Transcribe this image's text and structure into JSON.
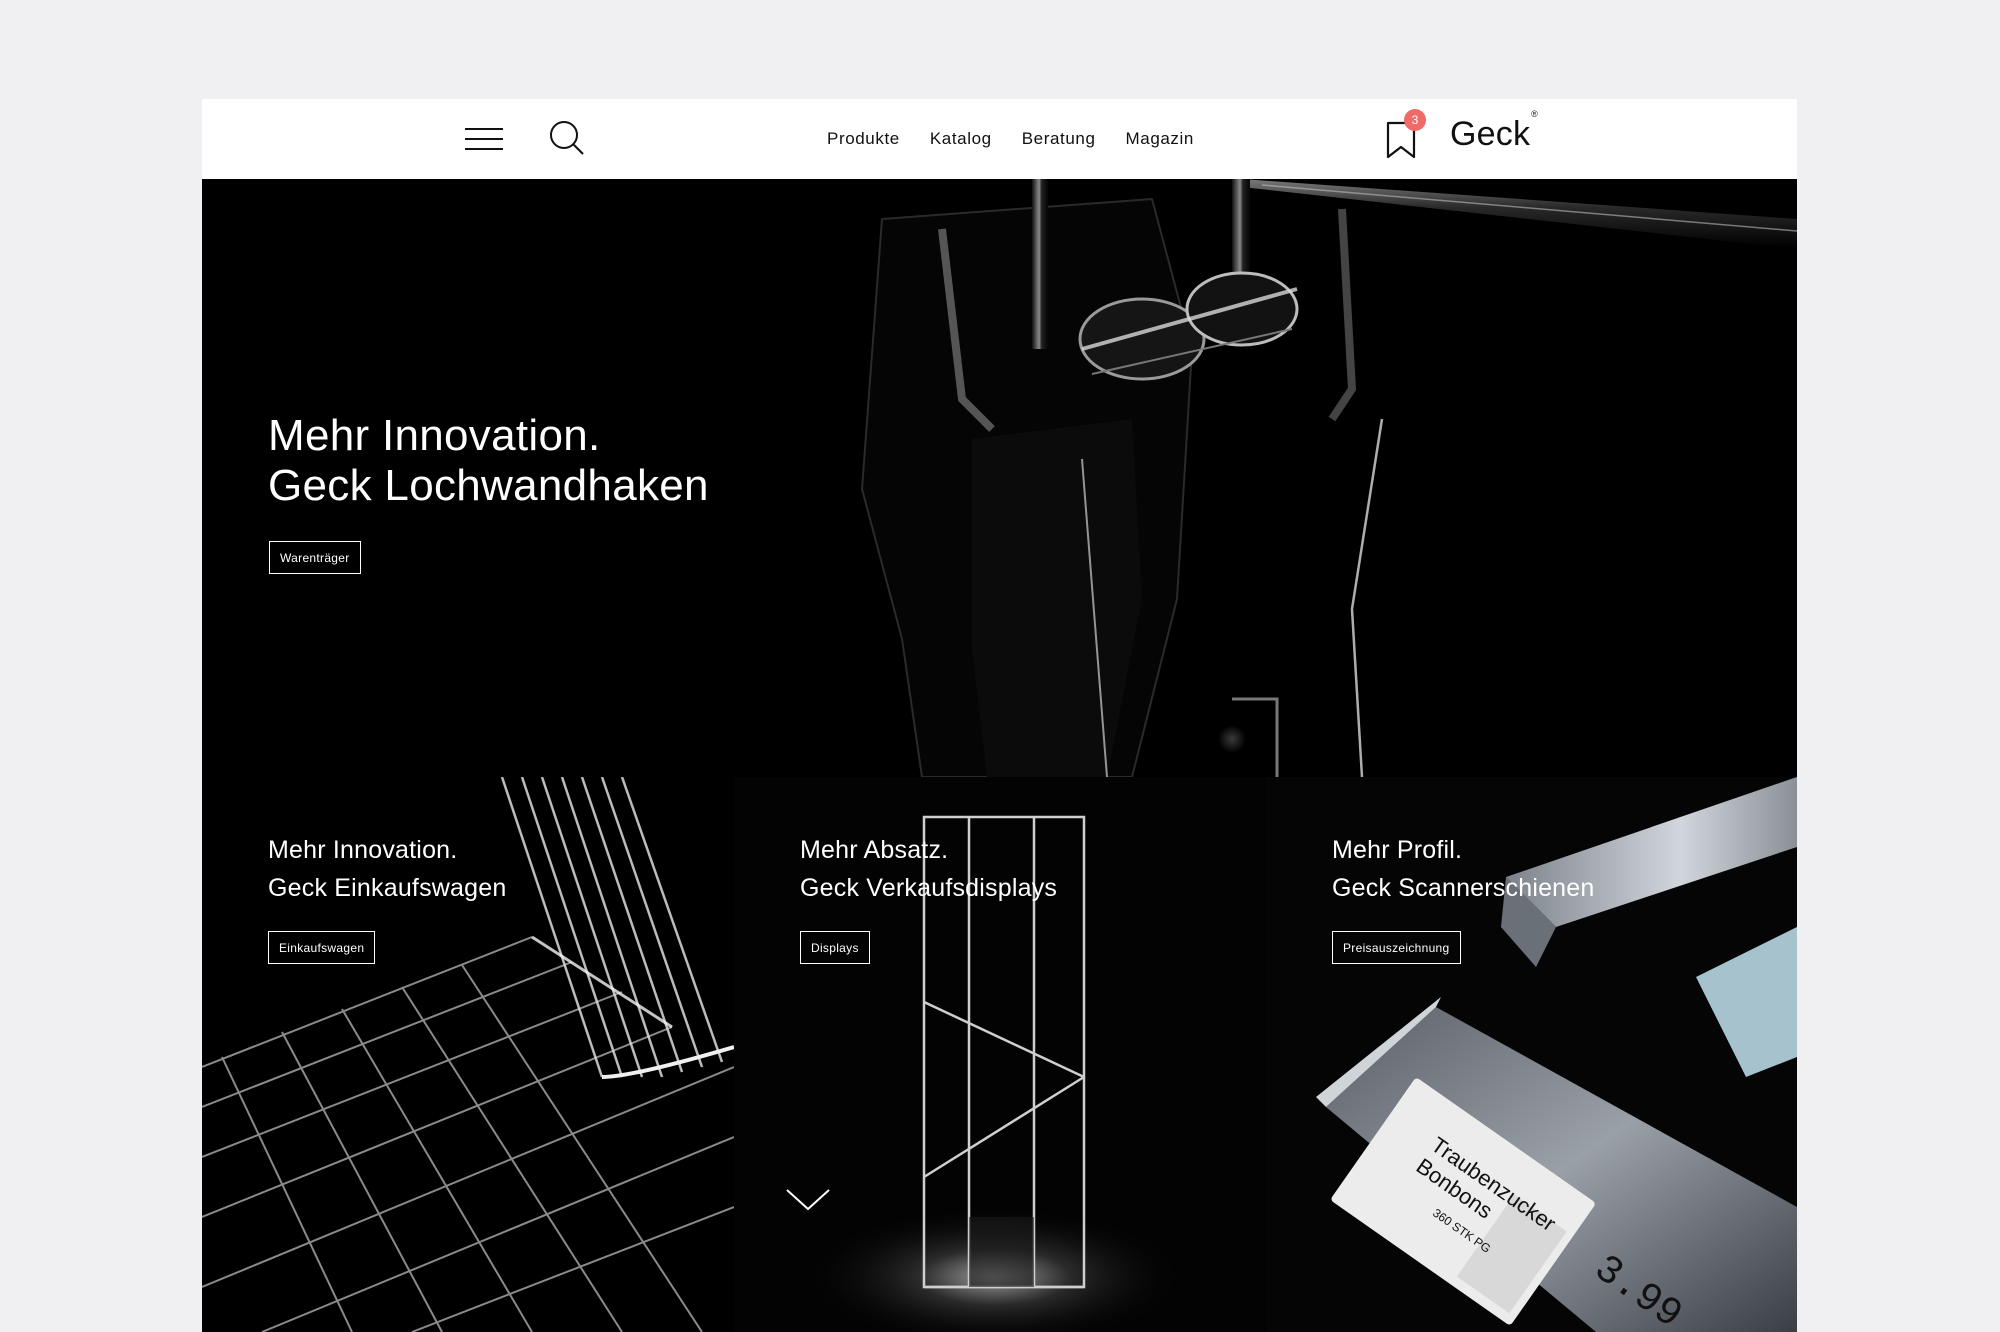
{
  "header": {
    "nav": [
      {
        "label": "Produkte"
      },
      {
        "label": "Katalog"
      },
      {
        "label": "Beratung"
      },
      {
        "label": "Magazin"
      }
    ],
    "bookmark_count": "3",
    "logo": "Geck",
    "logo_mark": "®"
  },
  "hero": {
    "line1": "Mehr Innovation.",
    "line2": "Geck Lochwandhaken",
    "button": "Warenträger"
  },
  "panels": [
    {
      "line1": "Mehr Innovation.",
      "line2": "Geck Einkaufswagen",
      "button": "Einkaufswagen"
    },
    {
      "line1": "Mehr Absatz.",
      "line2": "Geck Verkaufsdisplays",
      "button": "Displays"
    },
    {
      "line1": "Mehr Profil.",
      "line2": "Geck Scannerschienen",
      "button": "Preisauszeichnung"
    }
  ],
  "price_label": {
    "name1": "Traubenzucker",
    "name2": "Bonbons",
    "qty": "360 STK PG",
    "price": "3.99"
  },
  "colors": {
    "badge": "#f06a6a",
    "background": "#f0eff2",
    "panel": "#000000"
  }
}
